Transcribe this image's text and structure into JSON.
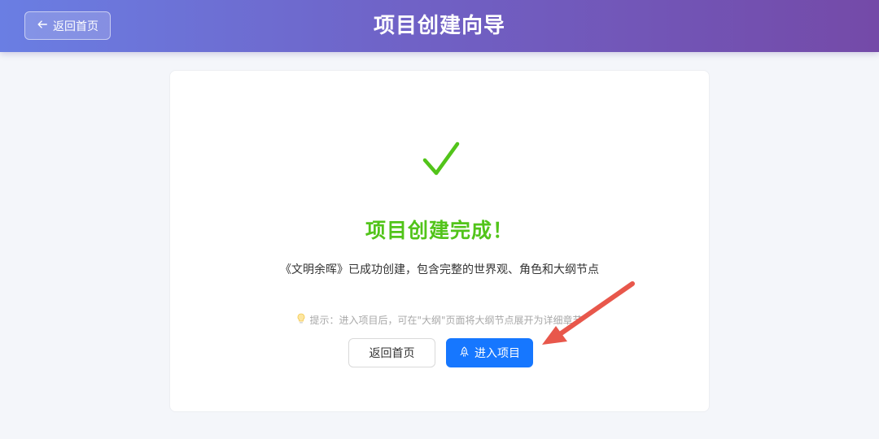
{
  "header": {
    "back_label": "返回首页",
    "title": "项目创建向导"
  },
  "result": {
    "icon": "check-icon",
    "title": "项目创建完成！",
    "description": "《文明余晖》已成功创建，包含完整的世界观、角色和大纲节点",
    "tip": "提示：进入项目后，可在\"大纲\"页面将大纲节点展开为详细章节"
  },
  "actions": {
    "home_label": "返回首页",
    "enter_label": "进入项目"
  },
  "colors": {
    "success": "#52c41a",
    "primary": "#1677ff",
    "annotation_arrow": "#e8574b"
  }
}
